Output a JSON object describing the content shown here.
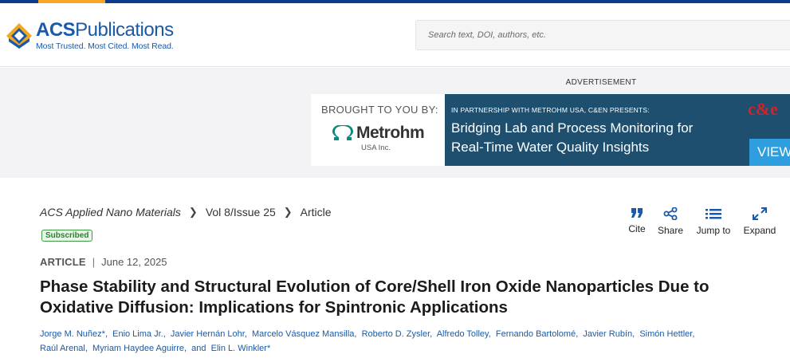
{
  "header": {
    "logo_title_prefix": "ACS",
    "logo_title_suffix": "Publications",
    "logo_tagline": "Most Trusted. Most Cited. Most Read.",
    "search_placeholder": "Search text, DOI, authors, etc."
  },
  "ad": {
    "label": "ADVERTISEMENT",
    "brought_by": "BROUGHT TO YOU BY:",
    "sponsor_name": "Metrohm",
    "sponsor_sub": "USA Inc.",
    "partnership": "IN PARTNERSHIP WITH METROHM USA, C&EN PRESENTS:",
    "headline_line1": "Bridging Lab and Process Monitoring for",
    "headline_line2": "Real-Time Water Quality Insights",
    "brand": "c&e",
    "cta": "VIEW"
  },
  "breadcrumb": {
    "journal": "ACS Applied Nano Materials",
    "issue": "Vol 8/Issue 25",
    "page": "Article"
  },
  "access_badge": "Subscribed",
  "tools": [
    {
      "label": "Cite",
      "icon": "quote-icon"
    },
    {
      "label": "Share",
      "icon": "share-icon"
    },
    {
      "label": "Jump to",
      "icon": "list-icon"
    },
    {
      "label": "Expand",
      "icon": "expand-icon"
    }
  ],
  "article": {
    "type": "ARTICLE",
    "separator": "|",
    "date": "June 12, 2025",
    "title_line1": "Phase Stability and Structural Evolution of Core/Shell Iron Oxide Nanoparticles Due to",
    "title_line2": "Oxidative Diffusion: Implications for Spintronic Applications",
    "authors_line1": [
      "Jorge M. Nuñez*",
      "Enio Lima Jr.",
      "Javier Hernán Lohr",
      "Marcelo Vásquez Mansilla",
      "Roberto D. Zysler",
      "Alfredo Tolley",
      "Fernando Bartolomé",
      "Javier Rubín",
      "Simón Hettler"
    ],
    "authors_line2": [
      "Raúl Arenal",
      "Myriam Haydee Aguirre"
    ],
    "authors_and": "and",
    "last_author": "Elin L. Winkler*"
  },
  "colors": {
    "brand_blue": "#1a5aa6",
    "top_bar": "#0c3a8c",
    "accent_orange": "#f5a623",
    "ad_panel": "#1f4f6e",
    "badge_green": "#2e7d32"
  }
}
